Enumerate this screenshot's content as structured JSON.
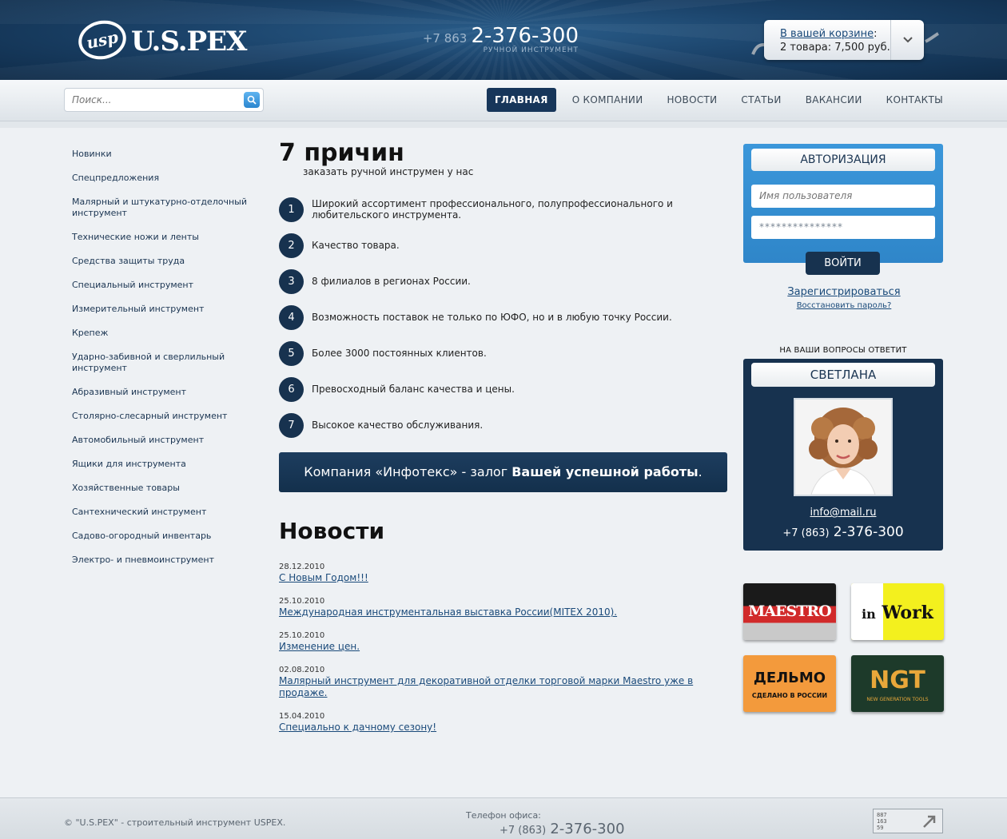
{
  "header": {
    "logo_badge": "usp",
    "logo_text": "U.S.PEX",
    "phone_code": "+7 863",
    "phone_number": "2-376-300",
    "phone_caption": "РУЧНОЙ ИНСТРУМЕНТ",
    "cart": {
      "link_label": "В вашей корзине",
      "link_suffix": ":",
      "summary": "2 товара: 7,500 руб."
    }
  },
  "search": {
    "placeholder": "Поиск..."
  },
  "menu": [
    {
      "label": "ГЛАВНАЯ",
      "active": true
    },
    {
      "label": "О КОМПАНИИ",
      "active": false
    },
    {
      "label": "НОВОСТИ",
      "active": false
    },
    {
      "label": "СТАТЬИ",
      "active": false
    },
    {
      "label": "ВАКАНСИИ",
      "active": false
    },
    {
      "label": "КОНТАКТЫ",
      "active": false
    }
  ],
  "categories": [
    "Новинки",
    "Спецпредложения",
    "Малярный и штукатурно-отделочный инструмент",
    "Технические ножи и ленты",
    "Средства защиты труда",
    "Специальный инструмент",
    "Измерительный инструмент",
    "Крепеж",
    "Ударно-забивной и сверлильный инструмент",
    "Абразивный инструмент",
    "Столярно-слесарный инструмент",
    "Автомобильный инструмент",
    "Ящики для инструмента",
    "Хозяйственные товары",
    "Сантехнический инструмент",
    "Садово-огородный инвентарь",
    "Электро- и пневмоинструмент"
  ],
  "reasons": {
    "title": "7 причин",
    "subtitle": "заказать ручной инструмен у нас",
    "items": [
      {
        "num": "1",
        "text": "Широкий ассортимент профессионального, полупрофессионального и любительского инструмента."
      },
      {
        "num": "2",
        "text": "Качество товара."
      },
      {
        "num": "3",
        "text": "8 филиалов в регионах России."
      },
      {
        "num": "4",
        "text": "Возможность поставок не только по ЮФО, но и в любую точку России."
      },
      {
        "num": "5",
        "text": "Более 3000 постоянных клиентов."
      },
      {
        "num": "6",
        "text": "Превосходный баланс качества и цены."
      },
      {
        "num": "7",
        "text": "Высокое качество обслуживания."
      }
    ]
  },
  "banner": {
    "text_start": "Компания «Инфотекс» - залог ",
    "text_bold": "Вашей успешной работы",
    "text_end": "."
  },
  "news": {
    "title": "Новости",
    "items": [
      {
        "date": "28.12.2010",
        "title": "С Новым Годом!!!"
      },
      {
        "date": "25.10.2010",
        "title": "Международная инструментальная выставка России(MITEX 2010)."
      },
      {
        "date": "25.10.2010",
        "title": "Изменение цен."
      },
      {
        "date": "02.08.2010",
        "title": "Малярный инструмент для декоративной отделки торговой марки Maestro уже в продаже."
      },
      {
        "date": "15.04.2010",
        "title": "Специально к дачному сезону!"
      }
    ]
  },
  "auth": {
    "title": "АВТОРИЗАЦИЯ",
    "username_placeholder": "Имя пользователя",
    "password_value": "***************",
    "login_label": "ВОЙТИ",
    "register_label": "Зарегистрироваться",
    "restore_label": "Восстановить пароль?"
  },
  "helper": {
    "caption": "НА ВАШИ ВОПРОСЫ ОТВЕТИТ",
    "name": "СВЕТЛАНА",
    "email": "info@mail.ru",
    "phone_code": "+7 (863)",
    "phone_number": "2-376-300"
  },
  "brands": [
    {
      "name": "MAESTRO"
    },
    {
      "name_a": "in",
      "name_b": "Work"
    },
    {
      "name": "ДЕЛЬМО",
      "sub": "СДЕЛАНО В РОССИИ"
    },
    {
      "name": "NGT",
      "sub": "NEW GENERATION TOOLS"
    }
  ],
  "footer": {
    "copyright": "© \"U.S.PEX\" - строительный инструмент USPEX.",
    "phone_label": "Телефон офиса:",
    "phone_code": "+7 (863)",
    "phone_number": "2-376-300",
    "counter": [
      "887",
      "163",
      "59"
    ]
  },
  "colors": {
    "header_dark": "#0f2b48",
    "accent_blue": "#2f86c9",
    "navy": "#17324f",
    "link": "#1a4a7a"
  }
}
